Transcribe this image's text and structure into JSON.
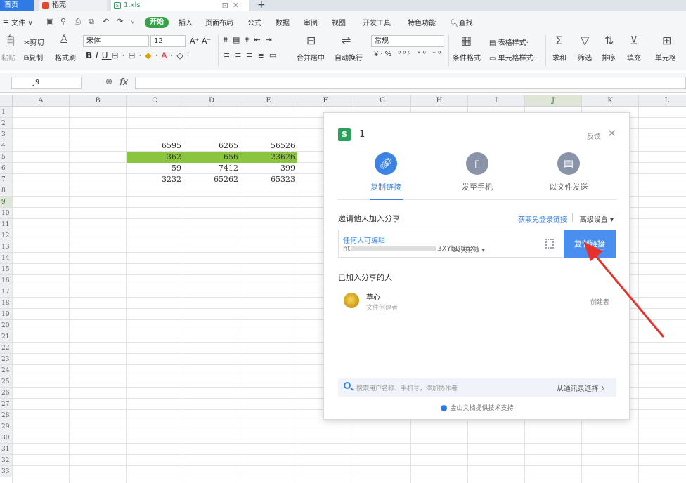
{
  "tabs": {
    "home": "首页",
    "docer": "稻壳",
    "file": "1.xls",
    "new_tab": "+"
  },
  "menu": {
    "file": "文件",
    "start": "开始",
    "items": [
      "插入",
      "页面布局",
      "公式",
      "数据",
      "审阅",
      "视图",
      "开发工具",
      "特色功能"
    ],
    "search": "查找"
  },
  "ribbon": {
    "paste": "粘贴",
    "cut": "剪切",
    "copy": "复制",
    "format_painter": "格式刷",
    "font_name": "宋体",
    "font_size": "12",
    "merge_center": "合并居中",
    "wrap_text": "自动换行",
    "number_format": "常规",
    "cond_format": "条件格式",
    "table_style": "表格样式",
    "cell_style": "单元格样式",
    "sum": "求和",
    "filter": "筛选",
    "sort": "排序",
    "fill": "填充",
    "cell": "单元格"
  },
  "formula_bar": {
    "name_box": "J9",
    "fx": "fx",
    "value": ""
  },
  "grid": {
    "columns": [
      "A",
      "B",
      "C",
      "D",
      "E",
      "F",
      "G",
      "H",
      "I",
      "J",
      "K",
      "L"
    ],
    "active_column": "J",
    "rows": [
      "1",
      "2",
      "3",
      "4",
      "5",
      "6",
      "7",
      "8",
      "9",
      "10",
      "11",
      "12",
      "13",
      "14",
      "15",
      "16",
      "17",
      "18",
      "19",
      "20",
      "21",
      "22",
      "23",
      "24",
      "25",
      "26",
      "27",
      "28",
      "29",
      "30",
      "31",
      "32",
      "33"
    ],
    "active_row": "9",
    "data": [
      [
        "6595",
        "6265",
        "56526"
      ],
      [
        "362",
        "656",
        "23626"
      ],
      [
        "59",
        "7412",
        "399"
      ],
      [
        "3232",
        "65262",
        "65323"
      ]
    ],
    "highlight_color": "#8bc53f"
  },
  "dialog": {
    "doc_title": "1",
    "feedback": "反馈",
    "options": [
      "复制链接",
      "发至手机",
      "以文件发送"
    ],
    "invite_title": "邀请他人加入分享",
    "get_link": "获取免登录链接",
    "advanced": "高级设置",
    "link_permission": "任何人可编辑",
    "link_url_start": "ht",
    "link_url_end": "3XYbDtinX",
    "link_validity": "30天有效",
    "copy_link_button": "复制链接",
    "joined_title": "已加入分享的人",
    "member": {
      "name": "草心",
      "desc": "文件创建者",
      "role": "创建者"
    },
    "search_placeholder": "搜索用户名称、手机号，添加协作者",
    "contacts_link": "从通讯录选择",
    "footer_note": "金山文档提供技术支持",
    "accent_color": "#3c83e6"
  }
}
